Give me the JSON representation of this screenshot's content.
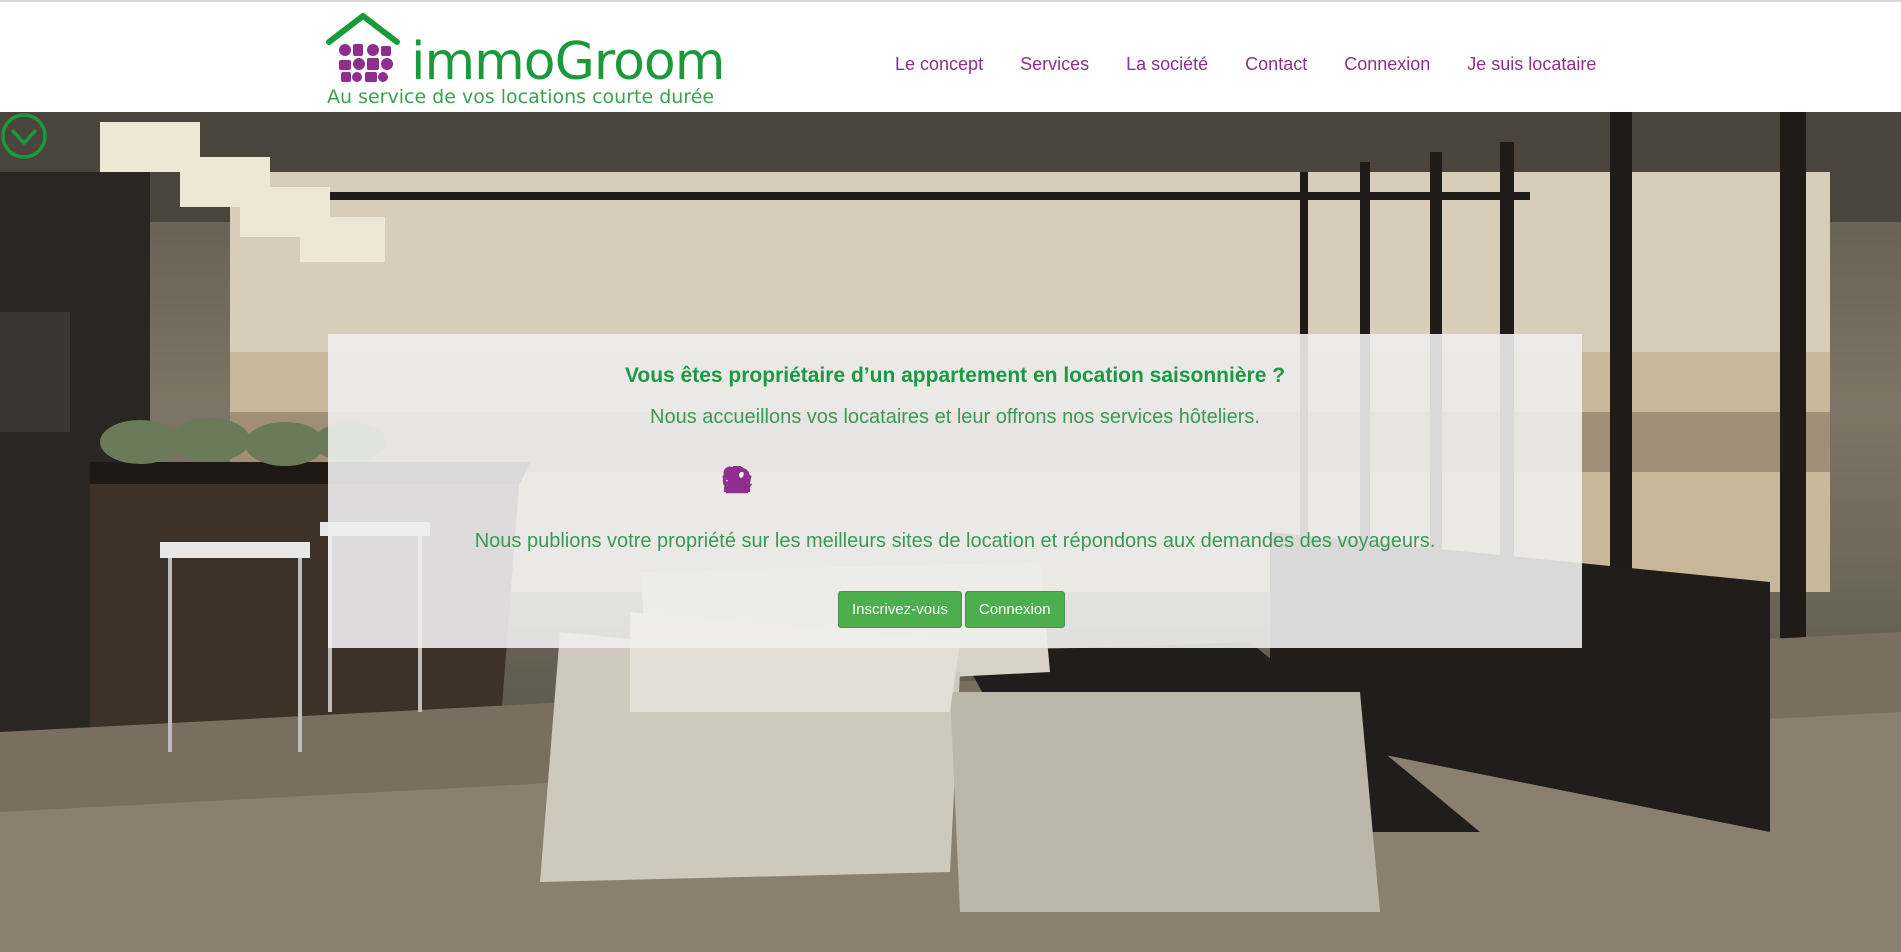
{
  "brand": {
    "name_prefix": "i",
    "name_rest": "mmoGroom",
    "tagline": "Au service de vos locations courte durée",
    "colors": {
      "green": "#1a9a3a",
      "purple": "#8e2f8e"
    }
  },
  "nav": {
    "items": [
      "Le concept",
      "Services",
      "La société",
      "Contact",
      "Connexion",
      "Je suis locataire"
    ]
  },
  "hero": {
    "question": "Vous êtes propriétaire d’un appartement en location saisonnière ?",
    "subtitle": "Nous accueillons vos locataires et leur offrons nos services hôteliers.",
    "service_icons": [
      "house-check-icon",
      "wifi-icon",
      "keys-icon",
      "basket-icon",
      "cleaning-icon",
      "luggage-icon",
      "airplane-icon",
      "concierge-icon",
      "payment-icon",
      "broom-icon",
      "repair-icon",
      "hospitality-icon"
    ],
    "publish_text": "Nous publions votre propriété sur les meilleurs sites de location et répondons aux demandes des voyageurs.",
    "buttons": {
      "signup": "Inscrivez-vous",
      "login": "Connexion"
    }
  }
}
